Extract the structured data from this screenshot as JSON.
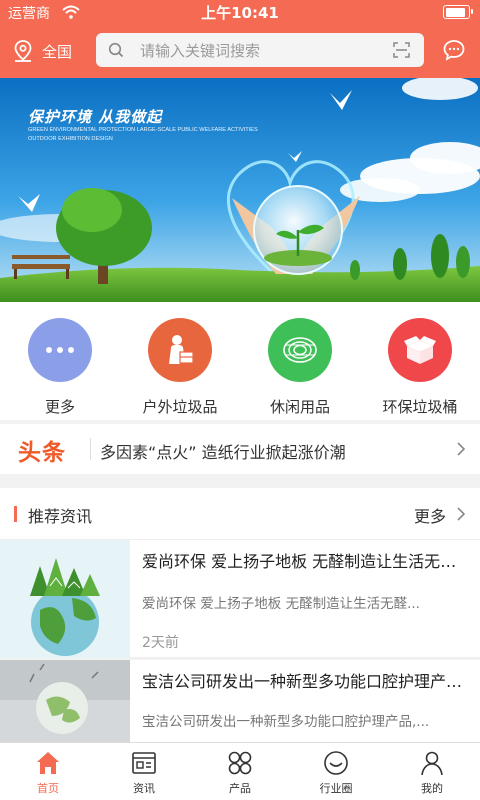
{
  "status_bar": {
    "carrier": "运营商",
    "time": "上午10:41"
  },
  "header": {
    "location": "全国",
    "search_placeholder": "请输入关键词搜索"
  },
  "banner": {
    "title": "保护环境  从我做起",
    "subtitle": "GREEN ENVIRONMENTAL PROTECTION LARGE-SCALE PUBLIC WELFARE ACTIVITIES OUTDOOR EXHIBITION DESIGN"
  },
  "categories": [
    {
      "label": "更多",
      "icon": "more-dots-icon",
      "color": "#8b9ee8"
    },
    {
      "label": "户外垃圾品",
      "icon": "delivery-person-icon",
      "color": "#e8663e"
    },
    {
      "label": "休闲用品",
      "icon": "roll-icon",
      "color": "#3fbf57"
    },
    {
      "label": "环保垃圾桶",
      "icon": "box-icon",
      "color": "#f0474a"
    }
  ],
  "headline": {
    "tag": "头条",
    "text": "多因素“点火” 造纸行业掀起涨价潮"
  },
  "recommended": {
    "title": "推荐资讯",
    "more": "更多"
  },
  "news": [
    {
      "title": "爱尚环保 爱上扬子地板 无醛制造让生活无醛...",
      "desc": "爱尚环保 爱上扬子地板 无醛制造让生活无醛...",
      "time": "2天前"
    },
    {
      "title": "宝洁公司研发出一种新型多功能口腔护理产品...",
      "desc": "宝洁公司研发出一种新型多功能口腔护理产品,..."
    }
  ],
  "tabs": [
    {
      "label": "首页",
      "active": true
    },
    {
      "label": "资讯"
    },
    {
      "label": "产品"
    },
    {
      "label": "行业圈"
    },
    {
      "label": "我的"
    }
  ],
  "colors": {
    "accent": "#f46a52",
    "headline_tag": "#f05a28"
  }
}
